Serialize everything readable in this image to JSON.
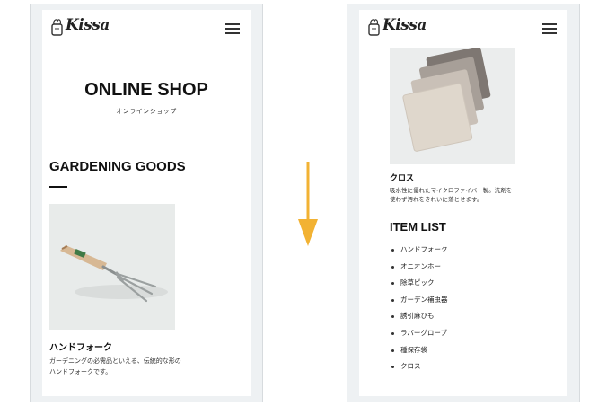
{
  "left_screen": {
    "logo_text": "Kissa",
    "hero_title": "ONLINE SHOP",
    "hero_subtitle": "オンラインショップ",
    "section_title": "GARDENING GOODS",
    "product": {
      "name": "ハンドフォーク",
      "description": "ガーデニングの必需品といえる、伝統的な形のハンドフォークです。"
    }
  },
  "right_screen": {
    "logo_text": "Kissa",
    "product": {
      "name": "クロス",
      "description": "吸水性に優れたマイクロファイバー製。洗剤を使わず汚れをきれいに落とせます。"
    },
    "list_title": "ITEM LIST",
    "items": [
      "ハンドフォーク",
      "オニオンホー",
      "除草ピック",
      "ガーデン補虫器",
      "誘引麻ひも",
      "ラバーグローブ",
      "種保存袋",
      "クロス"
    ]
  },
  "colors": {
    "arrow": "#f2b233",
    "frame": "#eef1f3"
  },
  "icons": [
    "menu-icon",
    "logo-mark-icon",
    "down-arrow-icon"
  ]
}
